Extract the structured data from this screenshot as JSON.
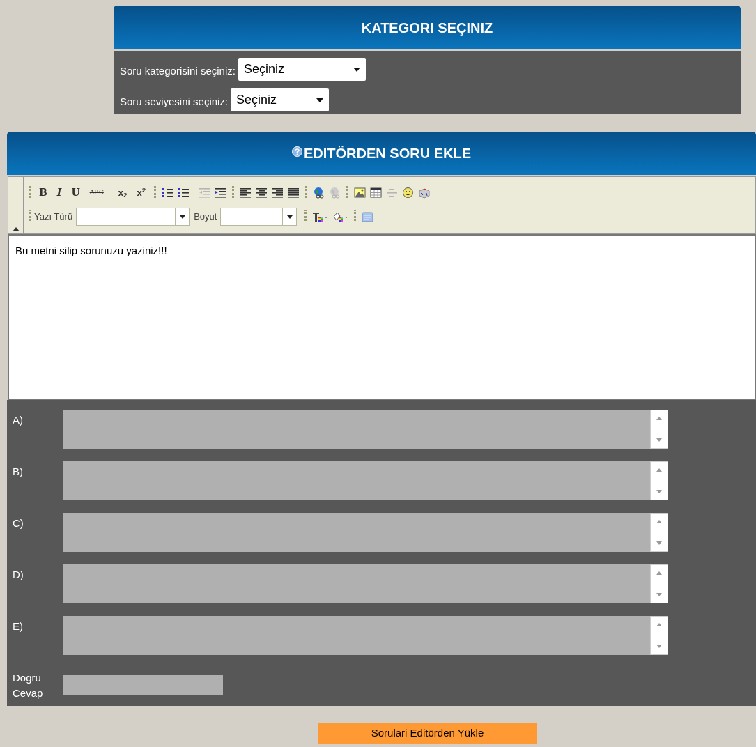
{
  "category_panel": {
    "title": "KATEGORI SEÇINIZ",
    "fields": [
      {
        "label": "Soru kategorisini seçiniz:",
        "value": "Seçiniz"
      },
      {
        "label": "Soru seviyesini seçiniz:",
        "value": "Seçiniz"
      }
    ]
  },
  "editor_panel": {
    "title": "EDITÖRDEN SORU EKLE",
    "toolbar": {
      "format_buttons": [
        "B",
        "I",
        "U",
        "ABC",
        "x$_{2}$",
        "x$^{2}$"
      ],
      "icon_buttons": [
        {
          "disabled": false
        },
        {
          "disabled": false
        },
        {
          "disabled": true
        },
        {
          "disabled": false
        },
        {
          "disabled": false
        },
        {
          "disabled": false
        },
        {
          "disabled": false
        },
        {
          "disabled": false
        },
        {
          "disabled": false
        },
        {
          "disabled": true
        },
        {
          "disabled": false
        },
        {
          "disabled": false
        },
        {
          "disabled": true
        },
        {
          "disabled": false
        },
        {
          "disabled": false
        },
        {
          "disabled": false
        },
        {
          "disabled": false
        },
        {
          "disabled": false
        }
      ],
      "select_labels": [
        "Yazı Türü",
        "Boyut"
      ]
    },
    "content": "Bu metni silip sorunuzu yaziniz!!!",
    "answers": [
      {
        "label": "A)"
      },
      {
        "label": "B)"
      },
      {
        "label": "C)"
      },
      {
        "label": "D)"
      },
      {
        "label": "E)"
      }
    ],
    "correct_answer": {
      "label_lines": [
        "Dogru",
        "Cevap"
      ]
    }
  },
  "submit_button": "Sorulari Editörden Yükle"
}
